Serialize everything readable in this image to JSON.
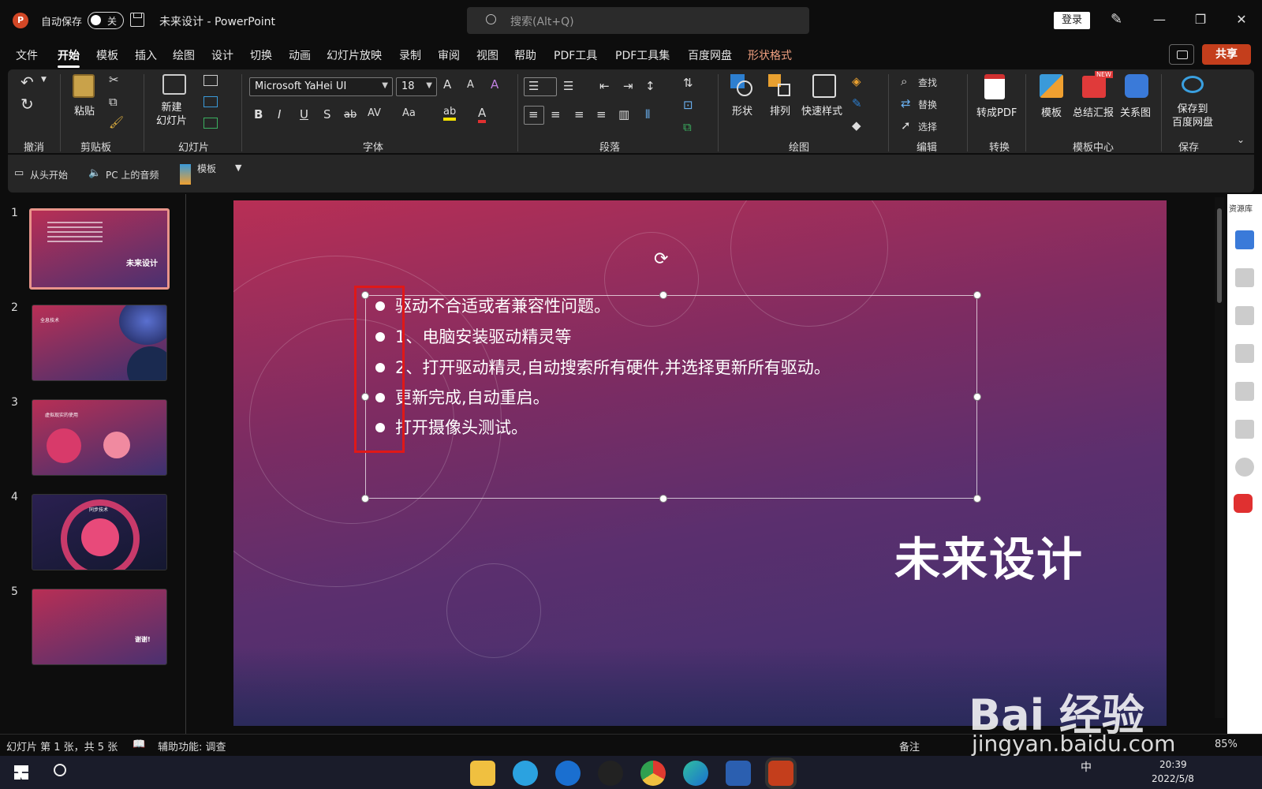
{
  "app": {
    "doc_title": "未来设计 - PowerPoint",
    "autosave_label": "自动保存",
    "autosave_state": "关",
    "logo": "P",
    "search_placeholder": "搜索(Alt+Q)",
    "login": "登录",
    "share": "共享"
  },
  "tabs": [
    "文件",
    "开始",
    "模板",
    "插入",
    "绘图",
    "设计",
    "切换",
    "动画",
    "幻灯片放映",
    "录制",
    "审阅",
    "视图",
    "帮助",
    "PDF工具",
    "PDF工具集",
    "百度网盘",
    "形状格式"
  ],
  "ribbon": {
    "groups": [
      "撤消",
      "剪贴板",
      "幻灯片",
      "字体",
      "段落",
      "绘图",
      "编辑",
      "转换",
      "模板中心",
      "保存"
    ],
    "paste": "粘贴",
    "new_slide": "新建\n幻灯片",
    "font_name": "Microsoft YaHei UI",
    "font_size": "18",
    "font_glyphs": {
      "bold": "B",
      "italic": "I",
      "underline": "U",
      "shadow": "S",
      "strike": "ab",
      "spacing": "AV",
      "case": "Aa",
      "grow": "A",
      "shrink": "A",
      "clear": "A",
      "highlight": "ab",
      "color": "A"
    },
    "shape": "形状",
    "arrange": "排列",
    "quick_style": "快速样式",
    "find": "查找",
    "replace": "替换",
    "select": "选择",
    "to_pdf": "转成PDF",
    "template": "模板",
    "summary": "总结汇报",
    "relation": "关系图",
    "save_baidu": "保存到\n百度网盘",
    "new_badge": "NEW"
  },
  "qat": {
    "from_start": "从头开始",
    "pc_audio": "PC 上的音频",
    "template": "模板"
  },
  "thumbnails": [
    {
      "num": "1",
      "title": "未来设计"
    },
    {
      "num": "2",
      "title": "全息技术"
    },
    {
      "num": "3",
      "title": "虚拟现实的使用"
    },
    {
      "num": "4",
      "title": "同步技术"
    },
    {
      "num": "5",
      "title": "谢谢!"
    }
  ],
  "slide": {
    "bullets": [
      "驱动不合适或者兼容性问题。",
      "1、电脑安装驱动精灵等",
      "2、打开驱动精灵,自动搜索所有硬件,并选择更新所有驱动。",
      "更新完成,自动重启。",
      "打开摄像头测试。"
    ],
    "title": "未来设计",
    "rotate_glyph": "⟳"
  },
  "right_panel": {
    "label": "资源库"
  },
  "status": {
    "slide_info": "幻灯片 第 1 张，共 5 张",
    "accessibility": "辅助功能: 调查",
    "notes": "备注",
    "zoom": "85%"
  },
  "taskbar": {
    "time": "20:39",
    "date": "2022/5/8",
    "ime": "中"
  },
  "watermark": {
    "brand": "Bai 经验",
    "url": "jingyan.baidu.com"
  }
}
